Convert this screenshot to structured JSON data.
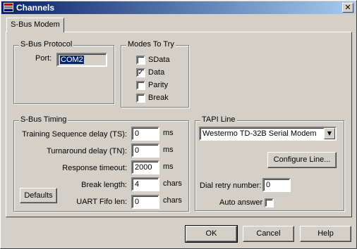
{
  "window": {
    "title": "Channels",
    "close_glyph": "✕"
  },
  "tabs": [
    {
      "label": "S-Bus Modem"
    }
  ],
  "protocol": {
    "group_label": "S-Bus Protocol",
    "port_label": "Port:",
    "port_value": "COM2"
  },
  "modes": {
    "group_label": "Modes To Try",
    "items": [
      {
        "label": "SData",
        "checked": false
      },
      {
        "label": "Data",
        "checked": true
      },
      {
        "label": "Parity",
        "checked": false
      },
      {
        "label": "Break",
        "checked": false
      }
    ],
    "check_glyph": "✓"
  },
  "timing": {
    "group_label": "S-Bus Timing",
    "rows": [
      {
        "label": "Training Sequence delay (TS):",
        "value": "0",
        "unit": "ms"
      },
      {
        "label": "Turnaround delay (TN):",
        "value": "0",
        "unit": "ms"
      },
      {
        "label": "Response timeout:",
        "value": "2000",
        "unit": "ms"
      },
      {
        "label": "Break length:",
        "value": "4",
        "unit": "chars"
      },
      {
        "label": "UART Fifo len:",
        "value": "0",
        "unit": "chars"
      }
    ],
    "defaults_label": "Defaults"
  },
  "tapi": {
    "group_label": "TAPI Line",
    "line_value": "Westermo TD-32B Serial Modem",
    "configure_label": "Configure Line...",
    "dial_retry_label": "Dial retry number:",
    "dial_retry_value": "0",
    "auto_answer_label": "Auto answer",
    "auto_answer_checked": false
  },
  "buttons": {
    "ok": "OK",
    "cancel": "Cancel",
    "help": "Help"
  }
}
